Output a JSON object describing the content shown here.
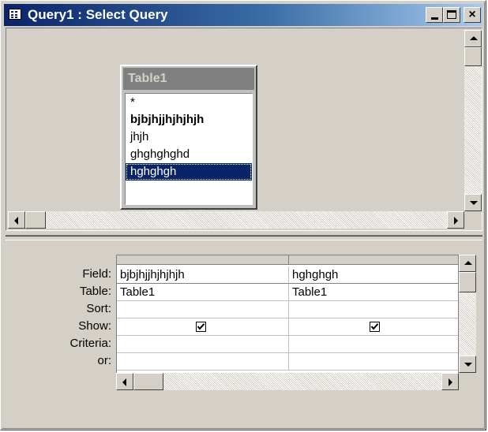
{
  "window": {
    "title": "Query1 : Select Query",
    "caption_buttons": {
      "minimize": "minimize",
      "maximize": "maximize",
      "close": "×"
    }
  },
  "table_box": {
    "title": "Table1",
    "fields": [
      "*",
      "bjbjhjjhjhjhjh",
      "jhjh",
      "ghghghghd",
      "hghghgh"
    ],
    "primary_key_field": "bjbjhjjhjhjhjh",
    "selected_field": "hghghgh"
  },
  "design_grid": {
    "row_labels": {
      "field": "Field:",
      "table": "Table:",
      "sort": "Sort:",
      "show": "Show:",
      "criteria": "Criteria:",
      "or": "or:"
    },
    "columns": [
      {
        "field": "bjbjhjjhjhjhjh",
        "table": "Table1",
        "sort": "",
        "show": true,
        "criteria": "",
        "or": ""
      },
      {
        "field": "hghghgh",
        "table": "Table1",
        "sort": "",
        "show": true,
        "criteria": "",
        "or": ""
      }
    ]
  },
  "colors": {
    "title_bar_start": "#0a246a",
    "title_bar_end": "#a6caf0",
    "selection": "#0a246a",
    "face": "#d4d0c8"
  },
  "icons": {
    "window_icon": "query-datasheet-icon",
    "scroll_up": "scroll-up-arrow-icon",
    "scroll_down": "scroll-down-arrow-icon",
    "scroll_left": "scroll-left-arrow-icon",
    "scroll_right": "scroll-right-arrow-icon",
    "checkbox": "checkbox-checked-icon"
  }
}
